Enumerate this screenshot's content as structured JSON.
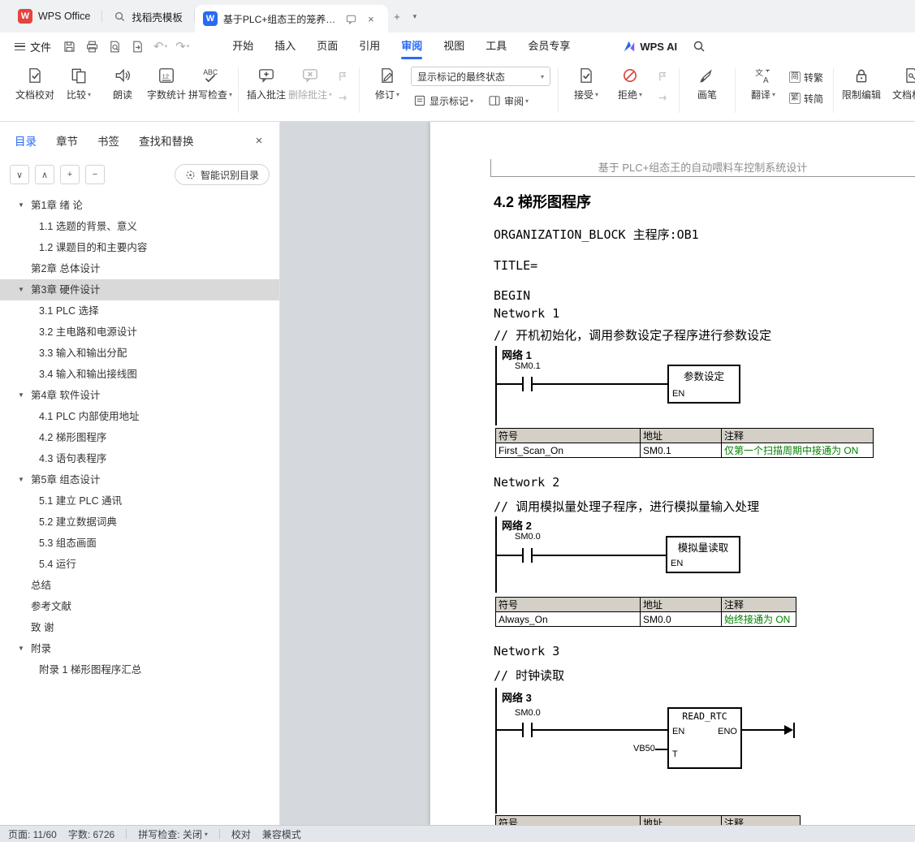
{
  "colors": {
    "accent": "#2a6af3",
    "green": "#008000",
    "selected_bg": "#d9d9d9",
    "reject_red": "#d9453a"
  },
  "icons": {
    "chevron": "▾",
    "close": "×",
    "plus": "+",
    "undo": "↶",
    "redo": "↷",
    "down": "∨",
    "up": "∧",
    "add": "+",
    "minus": "−",
    "tri": "▼",
    "jian": "简",
    "fan": "繁",
    "w": "W"
  },
  "titlebar": {
    "home_tab": "WPS Office",
    "template_tab": "找稻壳模板",
    "doc_tab": "基于PLC+组态王的笼养鸡养殖..."
  },
  "menubar": {
    "file": "文件",
    "tabs": [
      "开始",
      "插入",
      "页面",
      "引用",
      "审阅",
      "视图",
      "工具",
      "会员专享"
    ],
    "active_tab": "审阅",
    "ai": "WPS AI"
  },
  "ribbon": {
    "proof": "文档校对",
    "compare": "比较",
    "read": "朗读",
    "count": "字数统计",
    "spell": "拼写检查",
    "insert_comment": "插入批注",
    "delete_comment": "删除批注",
    "revise": "修订",
    "markup_state": "显示标记的最终状态",
    "show_markup": "显示标记",
    "review": "审阅",
    "accept": "接受",
    "reject": "拒绝",
    "pen": "画笔",
    "translate": "翻译",
    "to_trad": "转繁",
    "to_simp": "转简",
    "restrict": "限制编辑",
    "doc_perm": "文档权限"
  },
  "sidebar": {
    "tabs": [
      "目录",
      "章节",
      "书签",
      "查找和替换"
    ],
    "active_tab": "目录",
    "smart_toc": "智能识别目录",
    "items": [
      {
        "label": "第1章  绪 论"
      },
      {
        "label": "1.1 选题的背景、意义"
      },
      {
        "label": "1.2 课题目的和主要内容"
      },
      {
        "label": "第2章  总体设计"
      },
      {
        "label": "第3章  硬件设计"
      },
      {
        "label": "3.1 PLC 选择"
      },
      {
        "label": "3.2 主电路和电源设计"
      },
      {
        "label": "3.3 输入和输出分配"
      },
      {
        "label": "3.4 输入和输出接线图"
      },
      {
        "label": "第4章  软件设计"
      },
      {
        "label": "4.1 PLC 内部使用地址"
      },
      {
        "label": "4.2 梯形图程序"
      },
      {
        "label": "4.3 语句表程序"
      },
      {
        "label": "第5章  组态设计"
      },
      {
        "label": "5.1 建立 PLC 通讯"
      },
      {
        "label": "5.2 建立数据词典"
      },
      {
        "label": "5.3 组态画面"
      },
      {
        "label": "5.4 运行"
      },
      {
        "label": "总结"
      },
      {
        "label": "参考文献"
      },
      {
        "label": "致 谢"
      },
      {
        "label": "附录"
      },
      {
        "label": "附录 1 梯形图程序汇总"
      }
    ]
  },
  "document": {
    "header": "基于 PLC+组态王的自动喂料车控制系统设计",
    "heading": "4.2 梯形图程序",
    "line1": "ORGANIZATION_BLOCK 主程序:OB1",
    "line2": "TITLE=",
    "line3": "BEGIN",
    "networks": [
      {
        "name": "Network 1",
        "comment": "// 开机初始化，调用参数设定子程序进行参数设定",
        "label": "网络 1",
        "contact": "SM0.1",
        "block": "参数设定",
        "en": "EN",
        "table": {
          "h": [
            "符号",
            "地址",
            "注释"
          ],
          "r": [
            "First_Scan_On",
            "SM0.1",
            "仅第一个扫描周期中接通为 ON"
          ]
        }
      },
      {
        "name": "Network 2",
        "comment": "// 调用模拟量处理子程序，进行模拟量输入处理",
        "label": "网络 2",
        "contact": "SM0.0",
        "block": "模拟量读取",
        "en": "EN",
        "table": {
          "h": [
            "符号",
            "地址",
            "注释"
          ],
          "r": [
            "Always_On",
            "SM0.0",
            "始终接通为 ON"
          ]
        }
      },
      {
        "name": "Network 3",
        "comment": "// 时钟读取",
        "label": "网络 3",
        "contact": "SM0.0",
        "block": "READ_RTC",
        "en": "EN",
        "eno": "ENO",
        "t": "T",
        "input": "VB50",
        "table": {
          "h": [
            "符号",
            "地址",
            "注释"
          ]
        }
      }
    ]
  },
  "statusbar": {
    "page": "页面: 11/60",
    "words": "字数: 6726",
    "spell": "拼写检查: 关闭",
    "proof": "校对",
    "mode": "兼容模式"
  }
}
